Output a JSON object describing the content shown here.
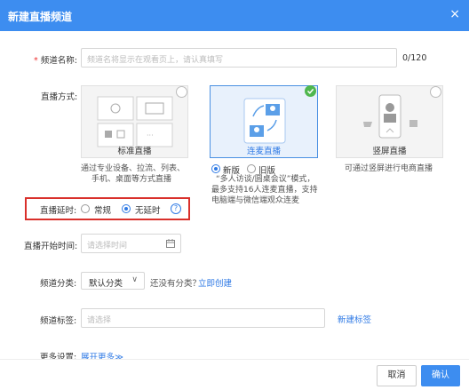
{
  "dialog": {
    "title": "新建直播频道",
    "close_label": "×"
  },
  "form": {
    "name": {
      "required_mark": "*",
      "label": "频道名称:",
      "placeholder": "频道名将显示在观看页上，请认真填写",
      "counter": "0/120"
    },
    "mode": {
      "label": "直播方式:",
      "cards": [
        {
          "label": "标准直播",
          "desc": [
            "通过专业设备、拉流、列表、",
            "手机、桌面等方式直播"
          ]
        },
        {
          "label": "连麦直播",
          "selected": true,
          "options": [
            {
              "label": "新版",
              "checked": true
            },
            {
              "label": "旧版",
              "checked": false
            }
          ],
          "desc": [
            "“多人访谈/圆桌会议”模式，",
            "最多支持16人连麦直播，支持",
            "电脑端与微信端观众连麦"
          ]
        },
        {
          "label": "竖屏直播",
          "desc": [
            "可通过竖屏进行电商直播"
          ]
        }
      ]
    },
    "delay": {
      "label": "直播延时:",
      "options": [
        {
          "label": "常规",
          "checked": false
        },
        {
          "label": "无延时",
          "checked": true
        }
      ],
      "help_icon": "question-circle-icon",
      "help_glyph": "?"
    },
    "start_time": {
      "label": "直播开始时间:",
      "placeholder": "请选择时间",
      "icon": "calendar-icon"
    },
    "category": {
      "label": "频道分类:",
      "selected": "默认分类",
      "caret": "∨",
      "hint": "还没有分类？",
      "create_link": "立即创建"
    },
    "tags": {
      "label": "频道标签:",
      "placeholder": "请选择",
      "new_tag_link": "新建标签"
    },
    "more": {
      "label": "更多设置:",
      "expand_link": "展开更多≫"
    }
  },
  "footer": {
    "cancel_label": "取消",
    "ok_label": "确认"
  },
  "colors": {
    "header": "#3d8df0",
    "accent": "#2f7ae5",
    "highlight_border": "#d9302b",
    "check_badge": "#4fb74f"
  }
}
